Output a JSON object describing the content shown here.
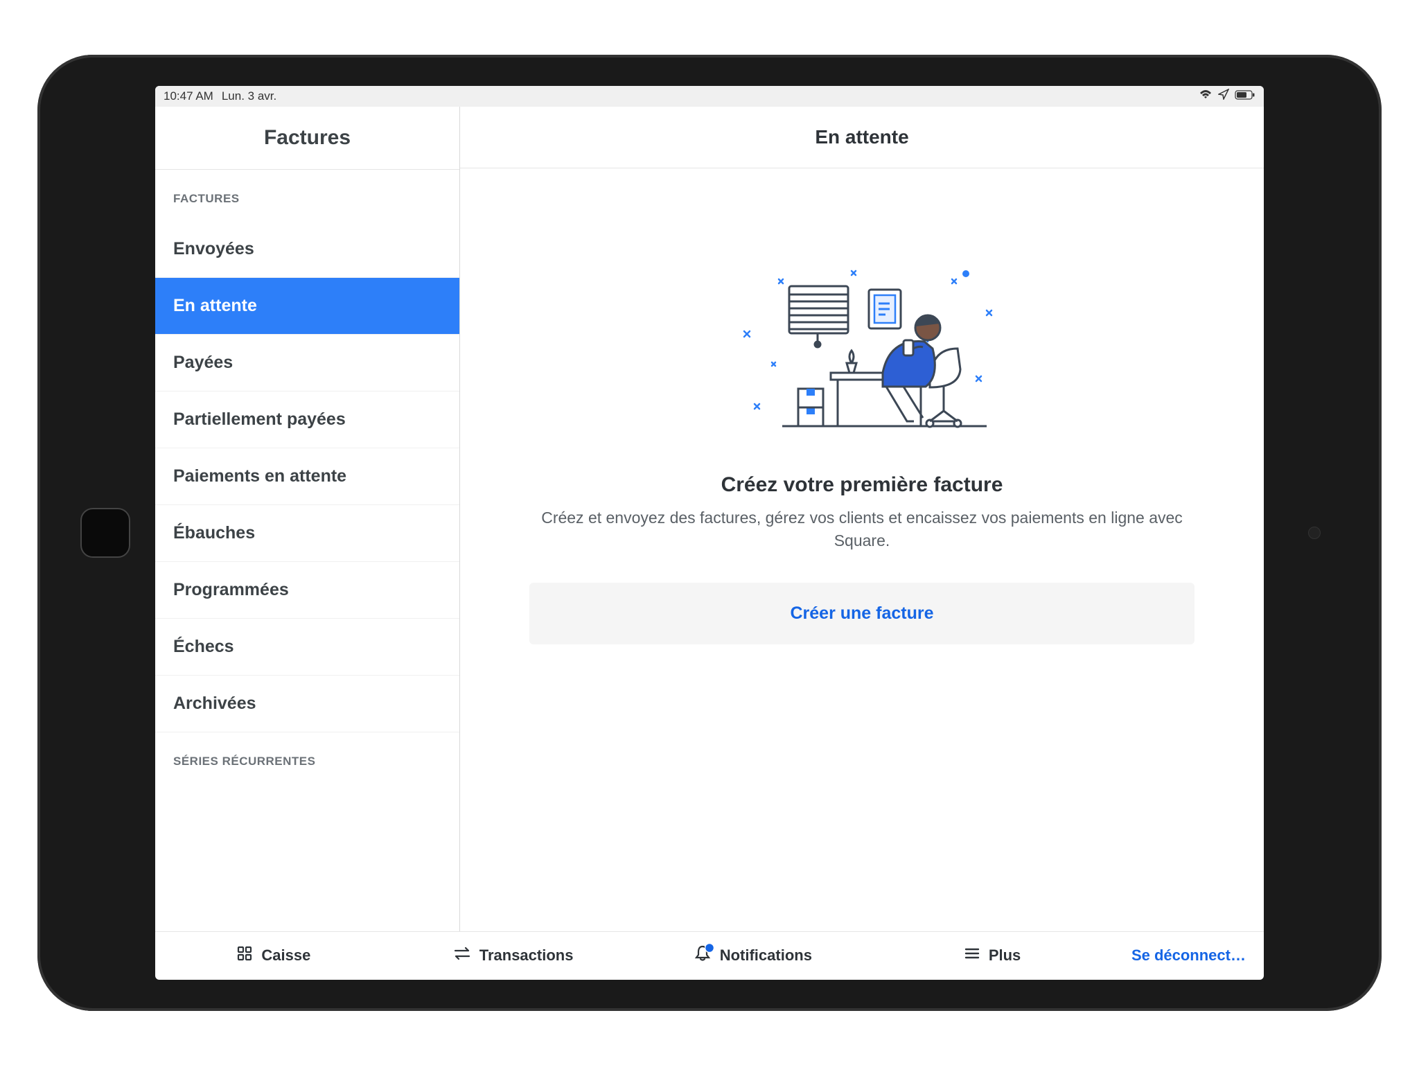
{
  "status": {
    "time": "10:47 AM",
    "date": "Lun. 3 avr."
  },
  "sidebar": {
    "title": "Factures",
    "section1": "FACTURES",
    "items": [
      "Envoyées",
      "En attente",
      "Payées",
      "Partiellement payées",
      "Paiements en attente",
      "Ébauches",
      "Programmées",
      "Échecs",
      "Archivées"
    ],
    "section2": "SÉRIES RÉCURRENTES",
    "active_index": 1
  },
  "main": {
    "title": "En attente",
    "empty_heading": "Créez votre première facture",
    "empty_desc": "Créez et envoyez des factures, gérez vos clients et encaissez vos paiements en ligne avec Square.",
    "create_button": "Créer une facture"
  },
  "nav": {
    "caisse": "Caisse",
    "transactions": "Transactions",
    "notifications": "Notifications",
    "plus": "Plus",
    "logout": "Se déconnect…"
  }
}
